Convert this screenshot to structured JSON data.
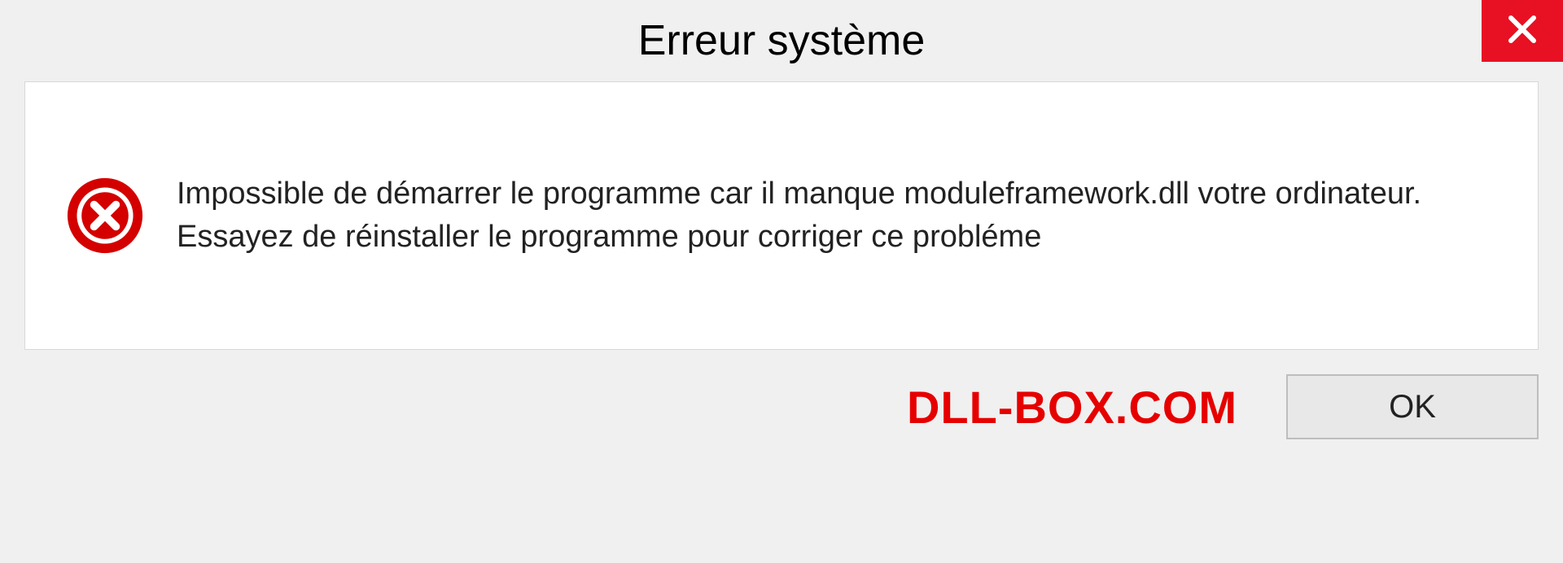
{
  "dialog": {
    "title": "Erreur système",
    "message": "Impossible de démarrer le programme car il manque moduleframework.dll votre ordinateur. Essayez de réinstaller le programme pour corriger ce probléme",
    "ok_label": "OK",
    "brand": "DLL-BOX.COM"
  },
  "colors": {
    "close_bg": "#e81123",
    "error_icon": "#d40000",
    "brand": "#e60000"
  }
}
